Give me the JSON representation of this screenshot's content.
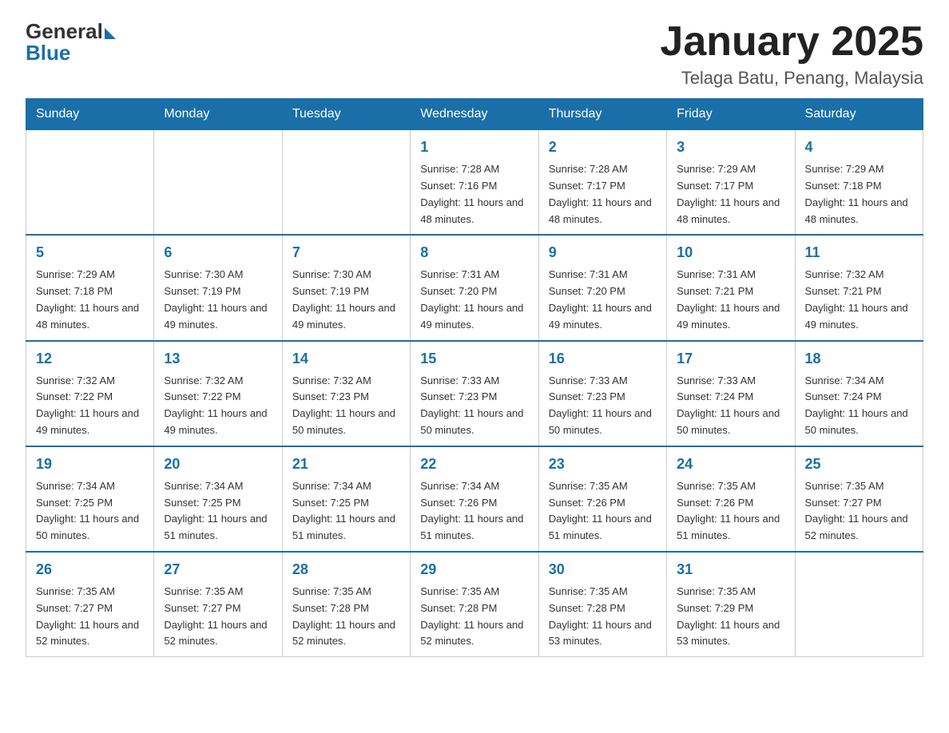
{
  "header": {
    "logo_general": "General",
    "logo_blue": "Blue",
    "month_title": "January 2025",
    "location": "Telaga Batu, Penang, Malaysia"
  },
  "weekdays": [
    "Sunday",
    "Monday",
    "Tuesday",
    "Wednesday",
    "Thursday",
    "Friday",
    "Saturday"
  ],
  "weeks": [
    [
      {
        "day": null,
        "info": null
      },
      {
        "day": null,
        "info": null
      },
      {
        "day": null,
        "info": null
      },
      {
        "day": "1",
        "info": "Sunrise: 7:28 AM\nSunset: 7:16 PM\nDaylight: 11 hours and 48 minutes."
      },
      {
        "day": "2",
        "info": "Sunrise: 7:28 AM\nSunset: 7:17 PM\nDaylight: 11 hours and 48 minutes."
      },
      {
        "day": "3",
        "info": "Sunrise: 7:29 AM\nSunset: 7:17 PM\nDaylight: 11 hours and 48 minutes."
      },
      {
        "day": "4",
        "info": "Sunrise: 7:29 AM\nSunset: 7:18 PM\nDaylight: 11 hours and 48 minutes."
      }
    ],
    [
      {
        "day": "5",
        "info": "Sunrise: 7:29 AM\nSunset: 7:18 PM\nDaylight: 11 hours and 48 minutes."
      },
      {
        "day": "6",
        "info": "Sunrise: 7:30 AM\nSunset: 7:19 PM\nDaylight: 11 hours and 49 minutes."
      },
      {
        "day": "7",
        "info": "Sunrise: 7:30 AM\nSunset: 7:19 PM\nDaylight: 11 hours and 49 minutes."
      },
      {
        "day": "8",
        "info": "Sunrise: 7:31 AM\nSunset: 7:20 PM\nDaylight: 11 hours and 49 minutes."
      },
      {
        "day": "9",
        "info": "Sunrise: 7:31 AM\nSunset: 7:20 PM\nDaylight: 11 hours and 49 minutes."
      },
      {
        "day": "10",
        "info": "Sunrise: 7:31 AM\nSunset: 7:21 PM\nDaylight: 11 hours and 49 minutes."
      },
      {
        "day": "11",
        "info": "Sunrise: 7:32 AM\nSunset: 7:21 PM\nDaylight: 11 hours and 49 minutes."
      }
    ],
    [
      {
        "day": "12",
        "info": "Sunrise: 7:32 AM\nSunset: 7:22 PM\nDaylight: 11 hours and 49 minutes."
      },
      {
        "day": "13",
        "info": "Sunrise: 7:32 AM\nSunset: 7:22 PM\nDaylight: 11 hours and 49 minutes."
      },
      {
        "day": "14",
        "info": "Sunrise: 7:32 AM\nSunset: 7:23 PM\nDaylight: 11 hours and 50 minutes."
      },
      {
        "day": "15",
        "info": "Sunrise: 7:33 AM\nSunset: 7:23 PM\nDaylight: 11 hours and 50 minutes."
      },
      {
        "day": "16",
        "info": "Sunrise: 7:33 AM\nSunset: 7:23 PM\nDaylight: 11 hours and 50 minutes."
      },
      {
        "day": "17",
        "info": "Sunrise: 7:33 AM\nSunset: 7:24 PM\nDaylight: 11 hours and 50 minutes."
      },
      {
        "day": "18",
        "info": "Sunrise: 7:34 AM\nSunset: 7:24 PM\nDaylight: 11 hours and 50 minutes."
      }
    ],
    [
      {
        "day": "19",
        "info": "Sunrise: 7:34 AM\nSunset: 7:25 PM\nDaylight: 11 hours and 50 minutes."
      },
      {
        "day": "20",
        "info": "Sunrise: 7:34 AM\nSunset: 7:25 PM\nDaylight: 11 hours and 51 minutes."
      },
      {
        "day": "21",
        "info": "Sunrise: 7:34 AM\nSunset: 7:25 PM\nDaylight: 11 hours and 51 minutes."
      },
      {
        "day": "22",
        "info": "Sunrise: 7:34 AM\nSunset: 7:26 PM\nDaylight: 11 hours and 51 minutes."
      },
      {
        "day": "23",
        "info": "Sunrise: 7:35 AM\nSunset: 7:26 PM\nDaylight: 11 hours and 51 minutes."
      },
      {
        "day": "24",
        "info": "Sunrise: 7:35 AM\nSunset: 7:26 PM\nDaylight: 11 hours and 51 minutes."
      },
      {
        "day": "25",
        "info": "Sunrise: 7:35 AM\nSunset: 7:27 PM\nDaylight: 11 hours and 52 minutes."
      }
    ],
    [
      {
        "day": "26",
        "info": "Sunrise: 7:35 AM\nSunset: 7:27 PM\nDaylight: 11 hours and 52 minutes."
      },
      {
        "day": "27",
        "info": "Sunrise: 7:35 AM\nSunset: 7:27 PM\nDaylight: 11 hours and 52 minutes."
      },
      {
        "day": "28",
        "info": "Sunrise: 7:35 AM\nSunset: 7:28 PM\nDaylight: 11 hours and 52 minutes."
      },
      {
        "day": "29",
        "info": "Sunrise: 7:35 AM\nSunset: 7:28 PM\nDaylight: 11 hours and 52 minutes."
      },
      {
        "day": "30",
        "info": "Sunrise: 7:35 AM\nSunset: 7:28 PM\nDaylight: 11 hours and 53 minutes."
      },
      {
        "day": "31",
        "info": "Sunrise: 7:35 AM\nSunset: 7:29 PM\nDaylight: 11 hours and 53 minutes."
      },
      {
        "day": null,
        "info": null
      }
    ]
  ]
}
